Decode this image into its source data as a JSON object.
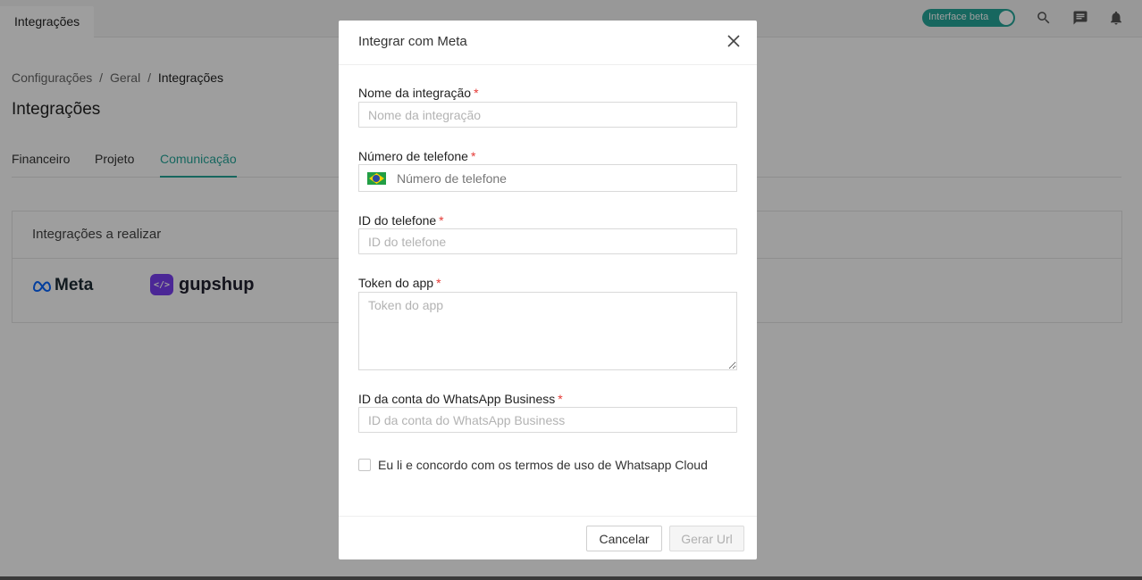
{
  "topbar": {
    "app_tab": "Integrações",
    "beta_toggle_label": "Interface beta",
    "icons": [
      "search-icon",
      "chat-icon",
      "bell-icon"
    ]
  },
  "breadcrumb": {
    "items": [
      "Configurações",
      "/",
      "Geral",
      "/",
      "Integrações"
    ]
  },
  "page": {
    "title": "Integrações",
    "tabs": [
      "Financeiro",
      "Projeto",
      "Comunicação"
    ],
    "active_tab": "Comunicação",
    "card_title": "Integrações a realizar",
    "providers": [
      {
        "name": "Meta",
        "icon": "meta-logo-icon"
      },
      {
        "name": "gupshup",
        "icon": "gupshup-logo-icon"
      }
    ]
  },
  "modal": {
    "title": "Integrar com Meta",
    "fields": {
      "integration_name": {
        "label": "Nome da integração",
        "placeholder": "Nome da integração",
        "value": ""
      },
      "phone_number": {
        "label": "Número de telefone",
        "placeholder": "Número de telefone",
        "value": "",
        "country_flag": "brazil-flag-icon"
      },
      "phone_id": {
        "label": "ID do telefone",
        "placeholder": "ID do telefone",
        "value": ""
      },
      "app_token": {
        "label": "Token do app",
        "placeholder": "Token do app",
        "value": ""
      },
      "whatsapp_business_id": {
        "label": "ID da conta do WhatsApp Business",
        "placeholder": "ID da conta do WhatsApp Business",
        "value": ""
      }
    },
    "required_marker": "*",
    "terms_checkbox": {
      "label": "Eu li e concordo com os termos de uso de Whatsapp Cloud",
      "checked": false
    },
    "buttons": {
      "cancel": "Cancelar",
      "submit": "Gerar Url"
    }
  },
  "colors": {
    "accent": "#26a69a",
    "required": "#e53935",
    "overlay": "rgba(0,0,0,0.38)"
  }
}
